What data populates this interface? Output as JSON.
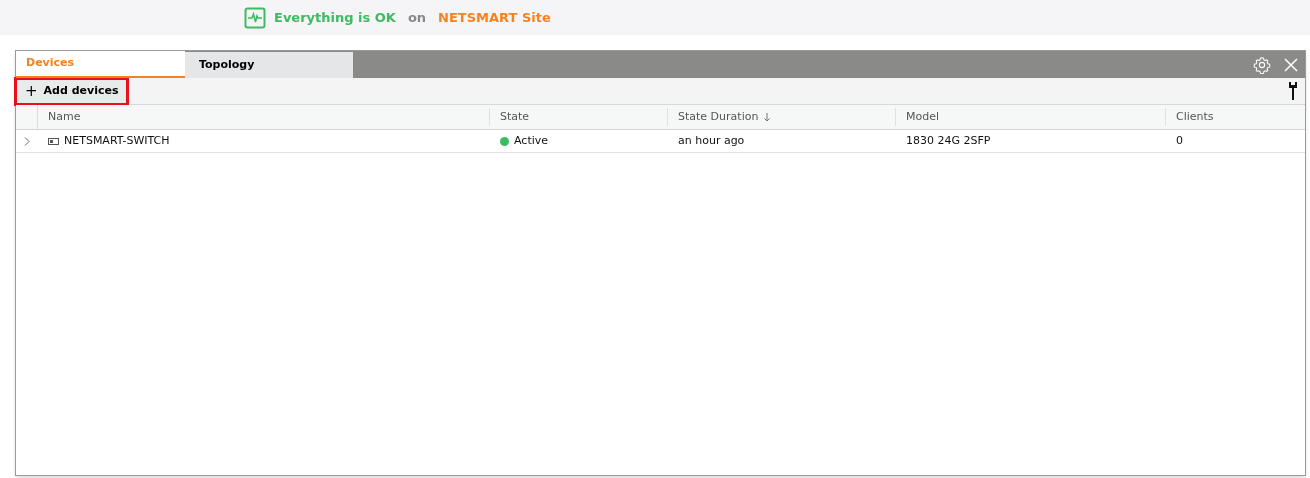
{
  "status": {
    "message": "Everything is OK",
    "connector": "on",
    "site": "NETSMART Site"
  },
  "tabs": [
    {
      "label": "Devices",
      "selected": true
    },
    {
      "label": "Topology",
      "selected": false
    }
  ],
  "toolbar": {
    "add_button": {
      "icon": "+",
      "label": "Add devices",
      "highlighted": true
    }
  },
  "table": {
    "columns": [
      {
        "label": "Name",
        "sorted": false
      },
      {
        "label": "State",
        "sorted": false
      },
      {
        "label": "State Duration",
        "sorted": true
      },
      {
        "label": "Model",
        "sorted": false
      },
      {
        "label": "Clients",
        "sorted": false
      }
    ],
    "rows": [
      {
        "expanded": false,
        "name": "NETSMART-SWITCH",
        "state": "Active",
        "color": "#3dbb61",
        "state_duration": "an hour ago",
        "model": "1830 24G 2SFP",
        "clients": "0"
      }
    ]
  }
}
